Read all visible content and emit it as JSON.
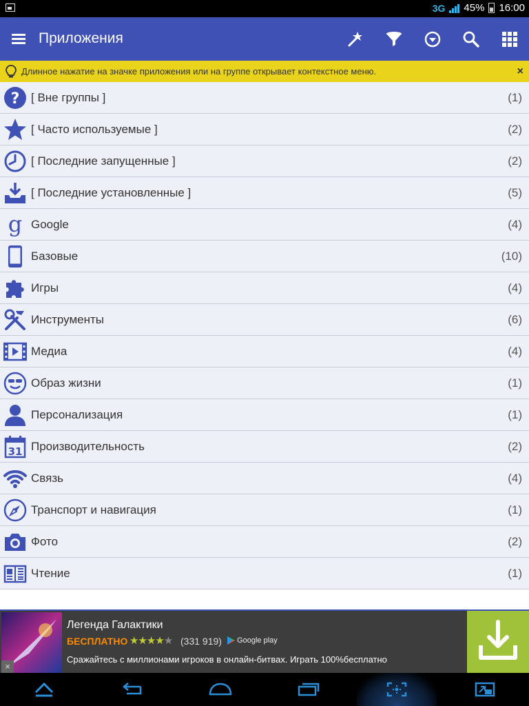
{
  "status": {
    "network": "3G",
    "battery": "45%",
    "time": "16:00"
  },
  "appbar": {
    "title": "Приложения",
    "actions": [
      "magic-wand-icon",
      "filter-icon",
      "dropdown-circle-icon",
      "search-icon",
      "grid-icon"
    ]
  },
  "hint": {
    "text": "Длинное нажатие на значке приложения или на группе открывает контекстное меню.",
    "close": "×"
  },
  "groups": [
    {
      "label": "[ Вне группы ]",
      "count": "(1)",
      "icon": "question-icon"
    },
    {
      "label": "[ Часто используемые ]",
      "count": "(2)",
      "icon": "star-icon"
    },
    {
      "label": "[ Последние запущенные ]",
      "count": "(2)",
      "icon": "clock-icon"
    },
    {
      "label": "[ Последние установленные ]",
      "count": "(5)",
      "icon": "download-tray-icon"
    },
    {
      "label": "Google",
      "count": "(4)",
      "icon": "google-g-icon"
    },
    {
      "label": "Базовые",
      "count": "(10)",
      "icon": "tablet-icon"
    },
    {
      "label": "Игры",
      "count": "(4)",
      "icon": "puzzle-icon"
    },
    {
      "label": "Инструменты",
      "count": "(6)",
      "icon": "tools-icon"
    },
    {
      "label": "Медиа",
      "count": "(4)",
      "icon": "film-icon"
    },
    {
      "label": "Образ жизни",
      "count": "(1)",
      "icon": "smiley-sunglasses-icon"
    },
    {
      "label": "Персонализация",
      "count": "(1)",
      "icon": "person-icon"
    },
    {
      "label": "Производительность",
      "count": "(2)",
      "icon": "calendar-icon"
    },
    {
      "label": "Связь",
      "count": "(4)",
      "icon": "wifi-icon"
    },
    {
      "label": "Транспорт и навигация",
      "count": "(1)",
      "icon": "compass-icon"
    },
    {
      "label": "Фото",
      "count": "(2)",
      "icon": "camera-icon"
    },
    {
      "label": "Чтение",
      "count": "(1)",
      "icon": "book-icon"
    }
  ],
  "ad": {
    "title": "Легенда Галактики",
    "price": "БЕСПЛАТНО",
    "rating": 4,
    "reviews": "(331 919)",
    "store": "Google play",
    "description": "Сражайтесь с миллионами игроков в онлайн-битвах. Играть 100%бесплатно",
    "close": "×"
  },
  "colors": {
    "accent": "#3f51b5",
    "hint": "#e9d31b",
    "row_bg": "#eef0f8",
    "install": "#9fc23a",
    "price": "#ff8a00"
  }
}
